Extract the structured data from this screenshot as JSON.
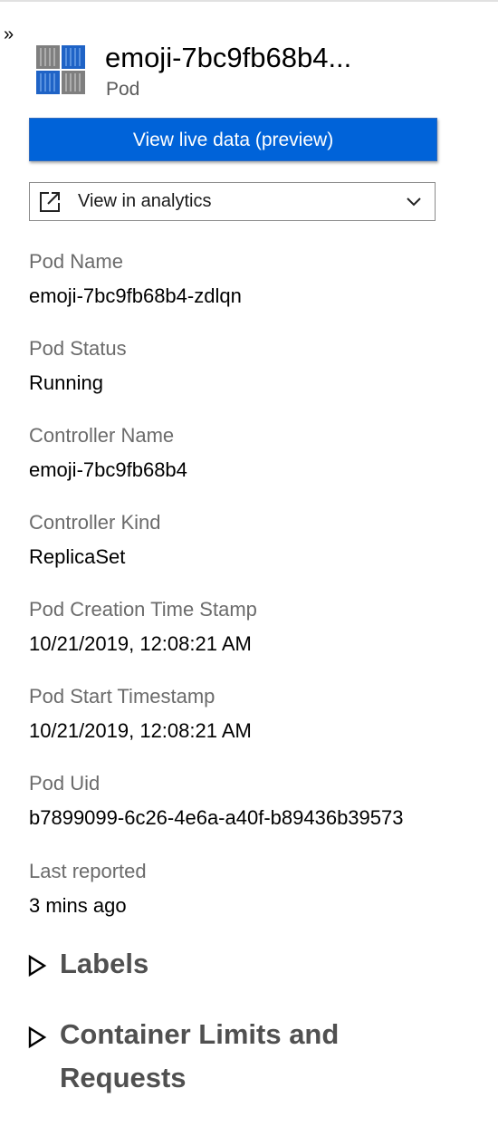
{
  "panel": {
    "collapse_glyph": "»",
    "title": "emoji-7bc9fb68b4...",
    "subtitle": "Pod",
    "icon": "pod-icon"
  },
  "actions": {
    "live_data_label": "View live data (preview)",
    "analytics_label": "View in analytics",
    "analytics_icon": "external-link-icon",
    "dropdown_icon": "chevron-down-icon"
  },
  "properties": [
    {
      "label": "Pod Name",
      "value": "emoji-7bc9fb68b4-zdlqn"
    },
    {
      "label": "Pod Status",
      "value": "Running"
    },
    {
      "label": "Controller Name",
      "value": "emoji-7bc9fb68b4"
    },
    {
      "label": "Controller Kind",
      "value": "ReplicaSet"
    },
    {
      "label": "Pod Creation Time Stamp",
      "value": "10/21/2019, 12:08:21 AM"
    },
    {
      "label": "Pod Start Timestamp",
      "value": "10/21/2019, 12:08:21 AM"
    },
    {
      "label": "Pod Uid",
      "value": "b7899099-6c26-4e6a-a40f-b89436b39573"
    },
    {
      "label": "Last reported",
      "value": "3 mins ago"
    }
  ],
  "sections": [
    {
      "title": "Labels",
      "expanded": false
    },
    {
      "title": "Container Limits and Requests",
      "expanded": false
    }
  ],
  "colors": {
    "accent": "#0063d9",
    "label_gray": "#6b6b6b",
    "section_gray": "#505050"
  }
}
